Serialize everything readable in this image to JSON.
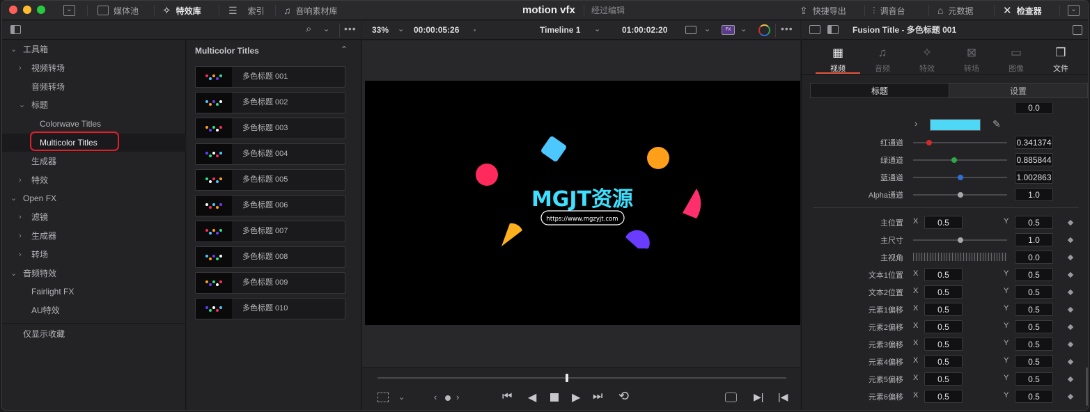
{
  "window": {
    "title": "motion vfx",
    "subtitle": "经过编辑"
  },
  "toolbar": {
    "media_pool": "媒体池",
    "effects_library": "特效库",
    "index": "索引",
    "sound_library": "音响素材库",
    "quick_export": "快捷导出",
    "mixer": "调音台",
    "metadata": "元数据",
    "inspector": "检查器"
  },
  "viewer_bar": {
    "zoom": "33%",
    "source_timecode": "00:00:05:26",
    "timeline_name": "Timeline 1",
    "record_timecode": "01:00:02:20"
  },
  "tree": {
    "items": [
      {
        "label": "工具箱",
        "level": 0,
        "chevron": "v"
      },
      {
        "label": "视频转场",
        "level": 1,
        "chevron": ">"
      },
      {
        "label": "音频转场",
        "level": 1,
        "chevron": ""
      },
      {
        "label": "标题",
        "level": 1,
        "chevron": "v"
      },
      {
        "label": "Colorwave Titles",
        "level": 2,
        "chevron": ""
      },
      {
        "label": "Multicolor Titles",
        "level": 2,
        "chevron": "",
        "selected": true
      },
      {
        "label": "生成器",
        "level": 1,
        "chevron": ""
      },
      {
        "label": "特效",
        "level": 1,
        "chevron": ">"
      },
      {
        "label": "Open FX",
        "level": 0,
        "chevron": "v"
      },
      {
        "label": "滤镜",
        "level": 1,
        "chevron": ">"
      },
      {
        "label": "生成器",
        "level": 1,
        "chevron": ">"
      },
      {
        "label": "转场",
        "level": 1,
        "chevron": ">"
      },
      {
        "label": "音频特效",
        "level": 0,
        "chevron": "v"
      },
      {
        "label": "Fairlight FX",
        "level": 1,
        "chevron": ""
      },
      {
        "label": "AU特效",
        "level": 1,
        "chevron": ""
      }
    ],
    "favorites_only": "仅显示收藏"
  },
  "effects": {
    "header": "Multicolor Titles",
    "items": [
      "多色标题 001",
      "多色标题 002",
      "多色标题 003",
      "多色标题 004",
      "多色标题 005",
      "多色标题 006",
      "多色标题 007",
      "多色标题 008",
      "多色标题 009",
      "多色标题 010"
    ]
  },
  "canvas": {
    "title_text": "MGJT资源",
    "url_text": "https://www.mgzyjt.com",
    "colors": {
      "red": "#ff2a5c",
      "blue": "#4cc8ff",
      "orange": "#ff9f1a",
      "pink": "#ff2f6e",
      "yellow": "#ffb01e",
      "purple": "#6a3cff",
      "cyan": "#3fe0ff"
    }
  },
  "inspector": {
    "title": "Fusion Title - 多色标题 001",
    "tabs": [
      "视频",
      "音频",
      "特效",
      "转场",
      "图像",
      "文件"
    ],
    "subtabs": [
      "标题",
      "设置"
    ],
    "top_value": "0.0",
    "swatch_color": "#4ed8f6",
    "channels": [
      {
        "label": "红通道",
        "value": "0.341374",
        "level": 0.17,
        "color": "#d22a2a"
      },
      {
        "label": "绿通道",
        "value": "0.885844",
        "level": 0.44,
        "color": "#2fa84a"
      },
      {
        "label": "蓝通道",
        "value": "1.002863",
        "level": 0.5,
        "color": "#2e6fd8"
      },
      {
        "label": "Alpha通道",
        "value": "1.0",
        "level": 0.5,
        "color": "#a8a8ac"
      }
    ],
    "master_position": {
      "label": "主位置",
      "x": "0.5",
      "y": "0.5"
    },
    "master_size": {
      "label": "主尺寸",
      "value": "1.0",
      "level": 0.5
    },
    "master_angle": {
      "label": "主视角",
      "value": "0.0"
    },
    "xy_rows": [
      {
        "label": "文本1位置",
        "x": "0.5",
        "y": "0.5"
      },
      {
        "label": "文本2位置",
        "x": "0.5",
        "y": "0.5"
      },
      {
        "label": "元素1偏移",
        "x": "0.5",
        "y": "0.5"
      },
      {
        "label": "元素2偏移",
        "x": "0.5",
        "y": "0.5"
      },
      {
        "label": "元素3偏移",
        "x": "0.5",
        "y": "0.5"
      },
      {
        "label": "元素4偏移",
        "x": "0.5",
        "y": "0.5"
      },
      {
        "label": "元素5偏移",
        "x": "0.5",
        "y": "0.5"
      },
      {
        "label": "元素6偏移",
        "x": "0.5",
        "y": "0.5"
      }
    ],
    "axis_x": "X",
    "axis_y": "Y"
  },
  "playback": {
    "progress": 0.46
  }
}
